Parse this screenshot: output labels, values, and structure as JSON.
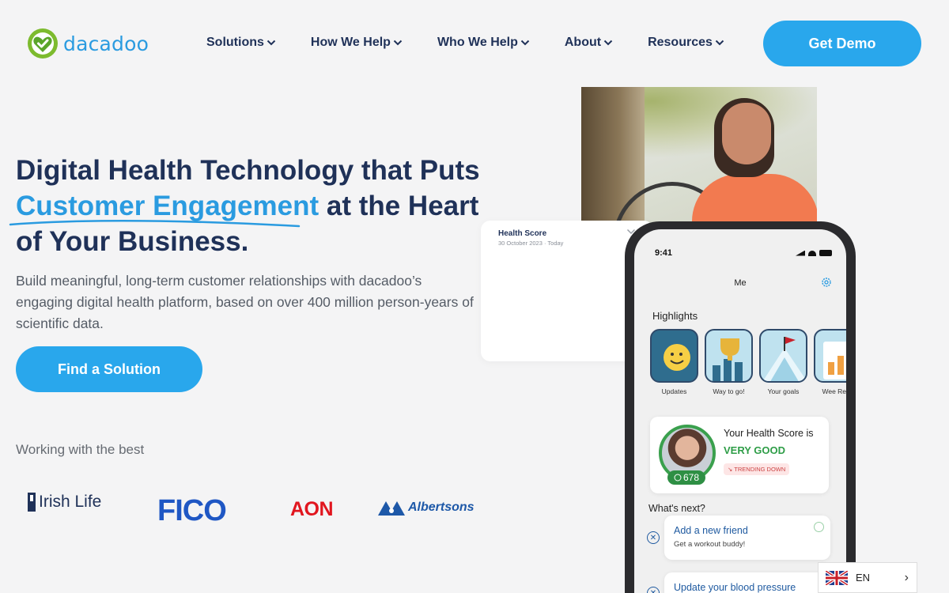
{
  "brand": {
    "name": "dacadoo",
    "accent": "#29a7ec",
    "navy": "#1f3158",
    "green": "#7dbb2e"
  },
  "nav": {
    "items": [
      {
        "label": "Solutions"
      },
      {
        "label": "How We Help"
      },
      {
        "label": "Who We Help"
      },
      {
        "label": "About"
      },
      {
        "label": "Resources"
      }
    ],
    "cta": "Get Demo"
  },
  "hero": {
    "title_line1": "Digital Health Technology that Puts",
    "title_accent": "Customer Engagement",
    "title_line2_rest": " at the Heart",
    "title_line3": "of Your Business.",
    "subtitle": "Build meaningful, long-term customer relationships with dacadoo’s engaging digital health platform, based on over 400 million person-years of scientific data.",
    "cta": "Find a Solution"
  },
  "partners": {
    "heading": "Working with the best",
    "logos": [
      "Irish Life",
      "FICO",
      "AON",
      "Albertsons"
    ]
  },
  "health_card": {
    "title": "Health Score",
    "date": "30 October 2023 · Today"
  },
  "phone": {
    "time": "9:41",
    "header": "Me",
    "highlights_label": "Highlights",
    "tiles": [
      {
        "label": "Updates",
        "icon": "smiley-icon"
      },
      {
        "label": "Way to go!",
        "icon": "trophy-icon"
      },
      {
        "label": "Your goals",
        "icon": "flag-icon"
      },
      {
        "label": "Wee Repo",
        "icon": "report-icon"
      }
    ],
    "score_label": "Your Health Score is",
    "score_value": "VERY GOOD",
    "score_number": "678",
    "trend": "TRENDING DOWN",
    "whats_next": "What's next?",
    "tasks": [
      {
        "title": "Add a new friend",
        "subtitle": "Get a workout buddy!"
      },
      {
        "title": "Update your blood pressure",
        "subtitle": ""
      }
    ]
  },
  "language": {
    "code": "EN"
  }
}
